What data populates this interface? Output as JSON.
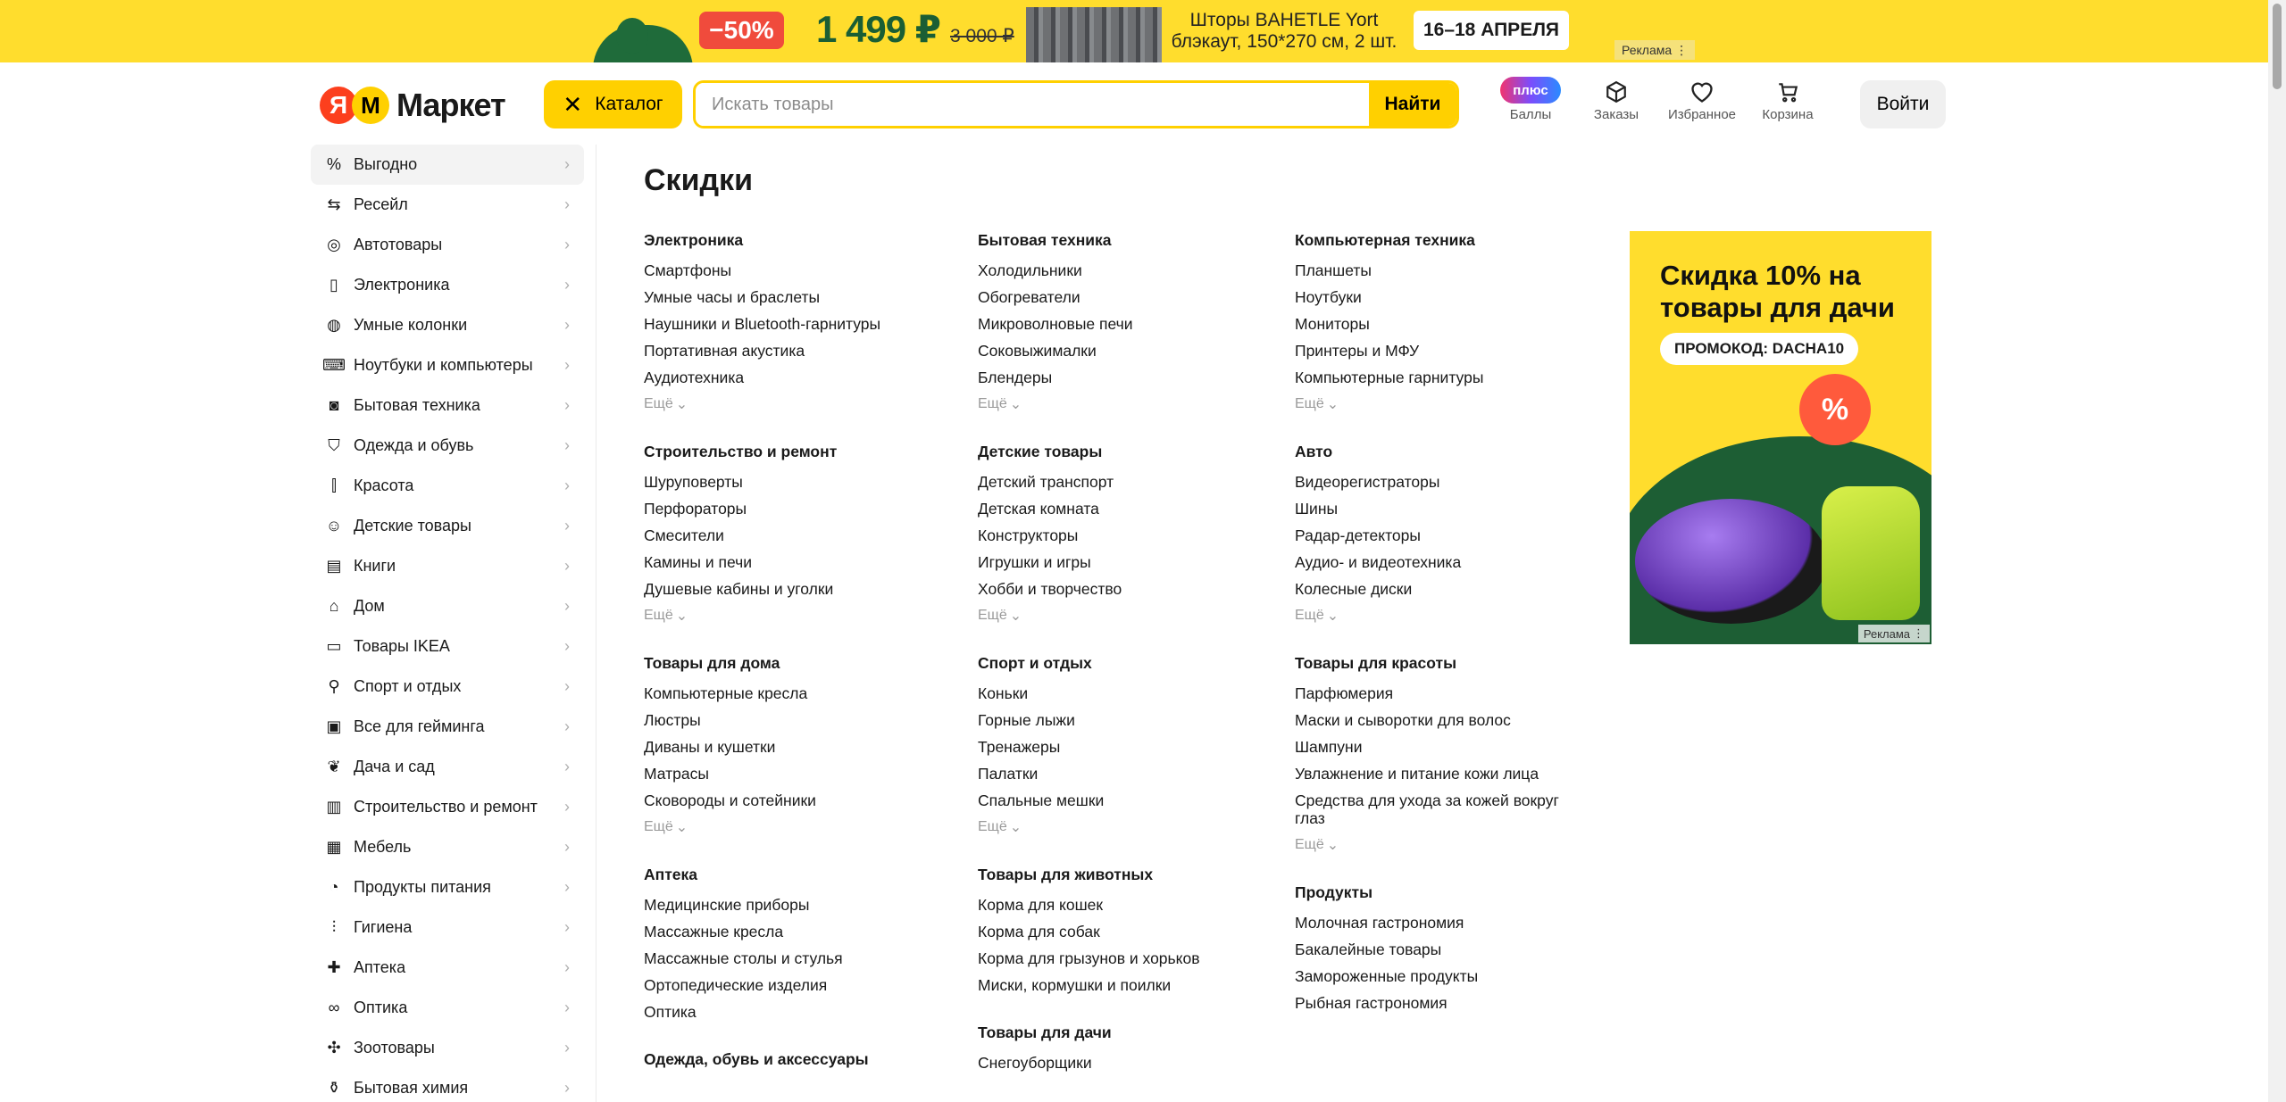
{
  "top_ad": {
    "discount": "−50%",
    "price": "1 499 ₽",
    "old_price": "3 000 ₽",
    "text_line1": "Шторы BAHETLE Yort",
    "text_line2": "блэкаут, 150*270 см, 2 шт.",
    "dates": "16–18 АПРЕЛЯ",
    "ad_label": "Реклама"
  },
  "header": {
    "logo_ya": "Я",
    "logo_m": "М",
    "logo_word": "Маркет",
    "catalog_label": "Каталог",
    "search_placeholder": "Искать товары",
    "search_button": "Найти",
    "plus_label": "плюс",
    "points_label": "Баллы",
    "orders_label": "Заказы",
    "favorites_label": "Избранное",
    "cart_label": "Корзина",
    "login_label": "Войти"
  },
  "sidebar": {
    "items": [
      {
        "label": "Выгодно",
        "icon": "percent-icon"
      },
      {
        "label": "Ресейл",
        "icon": "resale-icon"
      },
      {
        "label": "Автотовары",
        "icon": "wheel-icon"
      },
      {
        "label": "Электроника",
        "icon": "phone-icon"
      },
      {
        "label": "Умные колонки",
        "icon": "speaker-icon"
      },
      {
        "label": "Ноутбуки и компьютеры",
        "icon": "laptop-icon"
      },
      {
        "label": "Бытовая техника",
        "icon": "washer-icon"
      },
      {
        "label": "Одежда и обувь",
        "icon": "tshirt-icon"
      },
      {
        "label": "Красота",
        "icon": "lipstick-icon"
      },
      {
        "label": "Детские товары",
        "icon": "bear-icon"
      },
      {
        "label": "Книги",
        "icon": "book-icon"
      },
      {
        "label": "Дом",
        "icon": "home-icon"
      },
      {
        "label": "Товары IKEA",
        "icon": "ikea-icon"
      },
      {
        "label": "Спорт и отдых",
        "icon": "bike-icon"
      },
      {
        "label": "Все для гейминга",
        "icon": "gamepad-icon"
      },
      {
        "label": "Дача и сад",
        "icon": "leaf-icon"
      },
      {
        "label": "Строительство и ремонт",
        "icon": "roller-icon"
      },
      {
        "label": "Мебель",
        "icon": "cabinet-icon"
      },
      {
        "label": "Продукты питания",
        "icon": "apple-icon"
      },
      {
        "label": "Гигиена",
        "icon": "toothbrush-icon"
      },
      {
        "label": "Аптека",
        "icon": "cross-icon"
      },
      {
        "label": "Оптика",
        "icon": "glasses-icon"
      },
      {
        "label": "Зоотовары",
        "icon": "paw-icon"
      },
      {
        "label": "Бытовая химия",
        "icon": "bottle-icon"
      }
    ]
  },
  "main": {
    "title": "Скидки",
    "more_label": "Ещё",
    "columns": [
      [
        {
          "title": "Электроника",
          "links": [
            "Смартфоны",
            "Умные часы и браслеты",
            "Наушники и Bluetooth-гарнитуры",
            "Портативная акустика",
            "Аудиотехника"
          ],
          "more": true
        },
        {
          "title": "Строительство и ремонт",
          "links": [
            "Шуруповерты",
            "Перфораторы",
            "Смесители",
            "Камины и печи",
            "Душевые кабины и уголки"
          ],
          "more": true
        },
        {
          "title": "Товары для дома",
          "links": [
            "Компьютерные кресла",
            "Люстры",
            "Диваны и кушетки",
            "Матрасы",
            "Сковороды и сотейники"
          ],
          "more": true
        },
        {
          "title": "Аптека",
          "links": [
            "Медицинские приборы",
            "Массажные кресла",
            "Массажные столы и стулья",
            "Ортопедические изделия",
            "Оптика"
          ],
          "more": false
        },
        {
          "title": "Одежда, обувь и аксессуары",
          "links": [],
          "more": false
        }
      ],
      [
        {
          "title": "Бытовая техника",
          "links": [
            "Холодильники",
            "Обогреватели",
            "Микроволновые печи",
            "Соковыжималки",
            "Блендеры"
          ],
          "more": true
        },
        {
          "title": "Детские товары",
          "links": [
            "Детский транспорт",
            "Детская комната",
            "Конструкторы",
            "Игрушки и игры",
            "Хобби и творчество"
          ],
          "more": true
        },
        {
          "title": "Спорт и отдых",
          "links": [
            "Коньки",
            "Горные лыжи",
            "Тренажеры",
            "Палатки",
            "Спальные мешки"
          ],
          "more": true
        },
        {
          "title": "Товары для животных",
          "links": [
            "Корма для кошек",
            "Корма для собак",
            "Корма для грызунов и хорьков",
            "Миски, кормушки и поилки"
          ],
          "more": false
        },
        {
          "title": "Товары для дачи",
          "links": [
            "Снегоуборщики"
          ],
          "more": false
        }
      ],
      [
        {
          "title": "Компьютерная техника",
          "links": [
            "Планшеты",
            "Ноутбуки",
            "Мониторы",
            "Принтеры и МФУ",
            "Компьютерные гарнитуры"
          ],
          "more": true
        },
        {
          "title": "Авто",
          "links": [
            "Видеорегистраторы",
            "Шины",
            "Радар-детекторы",
            "Аудио- и видеотехника",
            "Колесные диски"
          ],
          "more": true
        },
        {
          "title": "Товары для красоты",
          "links": [
            "Парфюмерия",
            "Маски и сыворотки для волос",
            "Шампуни",
            "Увлажнение и питание кожи лица",
            "Средства для ухода за кожей вокруг глаз"
          ],
          "more": true
        },
        {
          "title": "Продукты",
          "links": [
            "Молочная гастрономия",
            "Бакалейные товары",
            "Замороженные продукты",
            "Рыбная гастрономия"
          ],
          "more": false
        }
      ]
    ]
  },
  "promo": {
    "title": "Скидка 10% на товары для дачи",
    "code": "ПРОМОКОД: DACHA10",
    "percent": "%",
    "ad_label": "Реклама"
  }
}
